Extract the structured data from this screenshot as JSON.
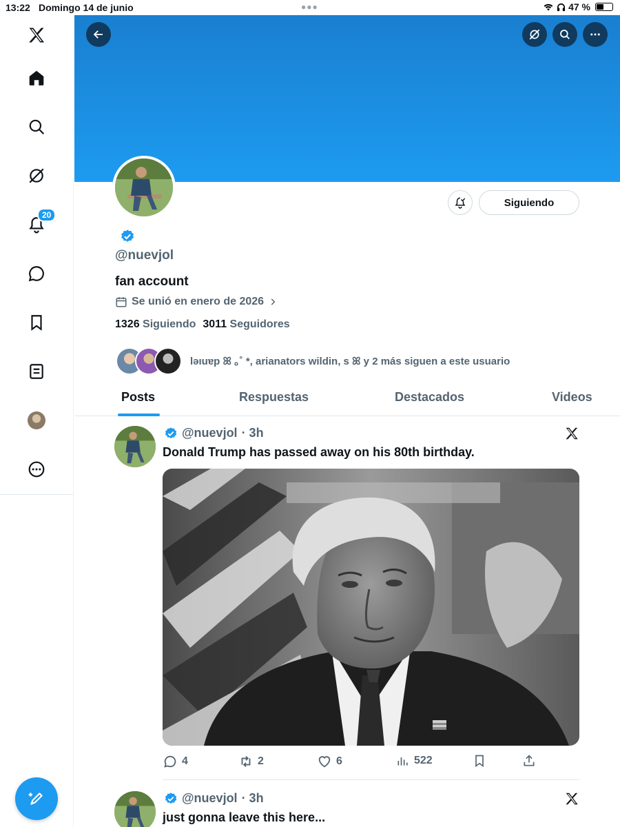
{
  "status_bar": {
    "time": "13:22",
    "date": "Domingo 14 de junio",
    "battery": "47 %"
  },
  "sidebar": {
    "notifications_badge": "20",
    "items": [
      "x-logo",
      "home-icon",
      "search-icon",
      "grok-icon",
      "bell-icon",
      "chat-icon",
      "bookmark-icon",
      "lists-icon",
      "profile-avatar",
      "more-icon"
    ]
  },
  "profile": {
    "handle": "@nuevjol",
    "bio": "fan account",
    "joined": "Se unió en enero de 2026",
    "following_count": "1326",
    "following_label": "Siguiendo",
    "followers_count": "3011",
    "followers_label": "Seguidores",
    "follow_button": "Siguiendo",
    "followed_by": "ləıuɐp ꕤ ｡˚ *, arianators wildin, s ꕤ y 2 más siguen a este usuario"
  },
  "tabs": [
    "Posts",
    "Respuestas",
    "Destacados",
    "Videos"
  ],
  "posts": [
    {
      "handle": "@nuevjol",
      "time": "· 3h",
      "text": "Donald Trump has passed away on his 80th birthday.",
      "replies": "4",
      "reposts": "2",
      "likes": "6",
      "views": "522"
    },
    {
      "handle": "@nuevjol",
      "time": "· 3h",
      "text": "just gonna leave this here..."
    }
  ],
  "colors": {
    "accent": "#1d9bf0",
    "text": "#0f1419",
    "muted": "#536471"
  }
}
